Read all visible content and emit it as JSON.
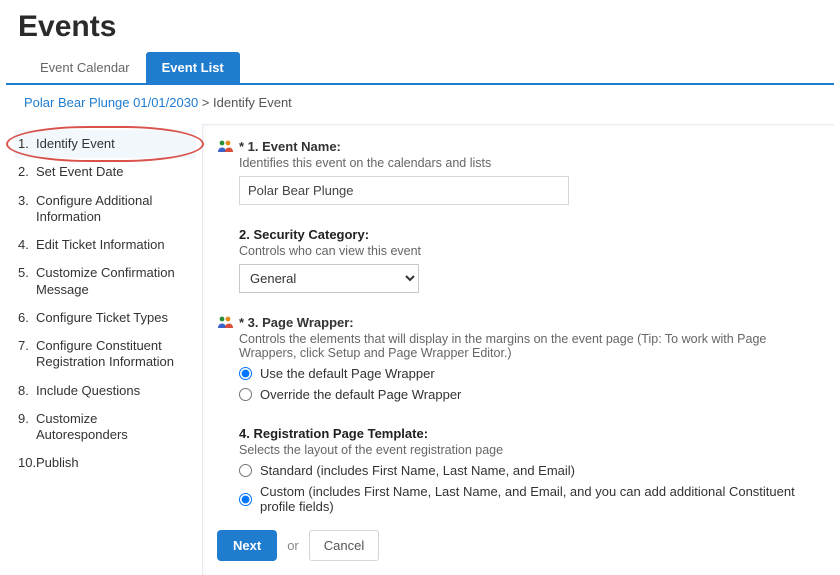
{
  "page_title": "Events",
  "tabs": {
    "calendar": "Event Calendar",
    "list": "Event List"
  },
  "breadcrumb": {
    "link": "Polar Bear Plunge 01/01/2030",
    "sep": " > ",
    "current": "Identify Event"
  },
  "sidebar": {
    "items": [
      {
        "num": "1.",
        "label": "Identify Event"
      },
      {
        "num": "2.",
        "label": "Set Event Date"
      },
      {
        "num": "3.",
        "label": "Configure Additional Information"
      },
      {
        "num": "4.",
        "label": "Edit Ticket Information"
      },
      {
        "num": "5.",
        "label": "Customize Confirmation Message"
      },
      {
        "num": "6.",
        "label": "Configure Ticket Types"
      },
      {
        "num": "7.",
        "label": "Configure Constituent Registration Information"
      },
      {
        "num": "8.",
        "label": "Include Questions"
      },
      {
        "num": "9.",
        "label": "Customize Autoresponders"
      },
      {
        "num": "10.",
        "label": "Publish"
      }
    ]
  },
  "form": {
    "event_name": {
      "label": "* 1. Event Name:",
      "help": "Identifies this event on the calendars and lists",
      "value": "Polar Bear Plunge"
    },
    "security": {
      "label": "2. Security Category:",
      "help": "Controls who can view this event",
      "value": "General"
    },
    "wrapper": {
      "label": "* 3. Page Wrapper:",
      "help": "Controls the elements that will display in the margins on the event page (Tip: To work with Page Wrappers, click Setup and Page Wrapper Editor.)",
      "opt_default": "Use the default Page Wrapper",
      "opt_override": "Override the default Page Wrapper"
    },
    "template": {
      "label": "4. Registration Page Template:",
      "help": "Selects the layout of the event registration page",
      "opt_standard": "Standard (includes First Name, Last Name, and Email)",
      "opt_custom": "Custom (includes First Name, Last Name, and Email, and you can add additional Constituent profile fields)"
    }
  },
  "buttons": {
    "next": "Next",
    "or": "or",
    "cancel": "Cancel"
  }
}
